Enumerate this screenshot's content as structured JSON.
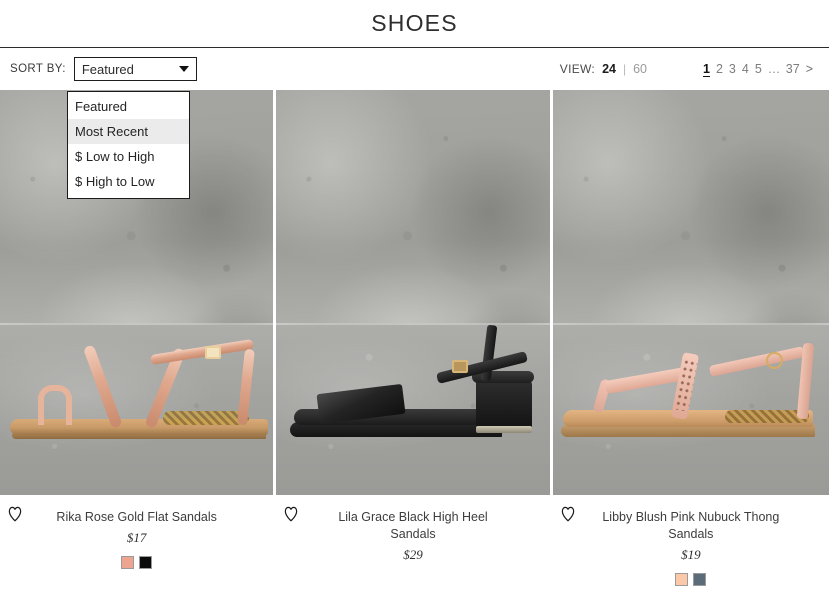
{
  "header": {
    "title": "SHOES"
  },
  "toolbar": {
    "sort_label": "SORT BY:",
    "sort_selected": "Featured",
    "sort_options": [
      {
        "label": "Featured",
        "highlighted": false
      },
      {
        "label": "Most Recent",
        "highlighted": true
      },
      {
        "label": "$ Low to High",
        "highlighted": false
      },
      {
        "label": "$ High to Low",
        "highlighted": false
      }
    ],
    "view_label": "VIEW:",
    "view_options": [
      {
        "label": "24",
        "active": true
      },
      {
        "label": "60",
        "active": false
      }
    ],
    "view_separator": "|",
    "pagination": {
      "pages": [
        "1",
        "2",
        "3",
        "4",
        "5"
      ],
      "current": "1",
      "ellipsis": "…",
      "last": "37",
      "next": ">"
    }
  },
  "products": [
    {
      "title": "Rika Rose Gold Flat Sandals",
      "price": "$17",
      "image_alt": "rose-gold-flat-sandal",
      "swatches": [
        "#eda591",
        "#0b0b0b"
      ]
    },
    {
      "title": "Lila Grace Black High Heel Sandals",
      "price": "$29",
      "image_alt": "black-block-heel-sandal",
      "swatches": []
    },
    {
      "title": "Libby Blush Pink Nubuck Thong Sandals",
      "price": "$19",
      "image_alt": "blush-pink-thong-sandal",
      "swatches": [
        "#fcc9a8",
        "#5b6b78"
      ]
    }
  ],
  "icons": {
    "wishlist": "heart-outline-icon",
    "dropdown": "chevron-down-icon"
  }
}
